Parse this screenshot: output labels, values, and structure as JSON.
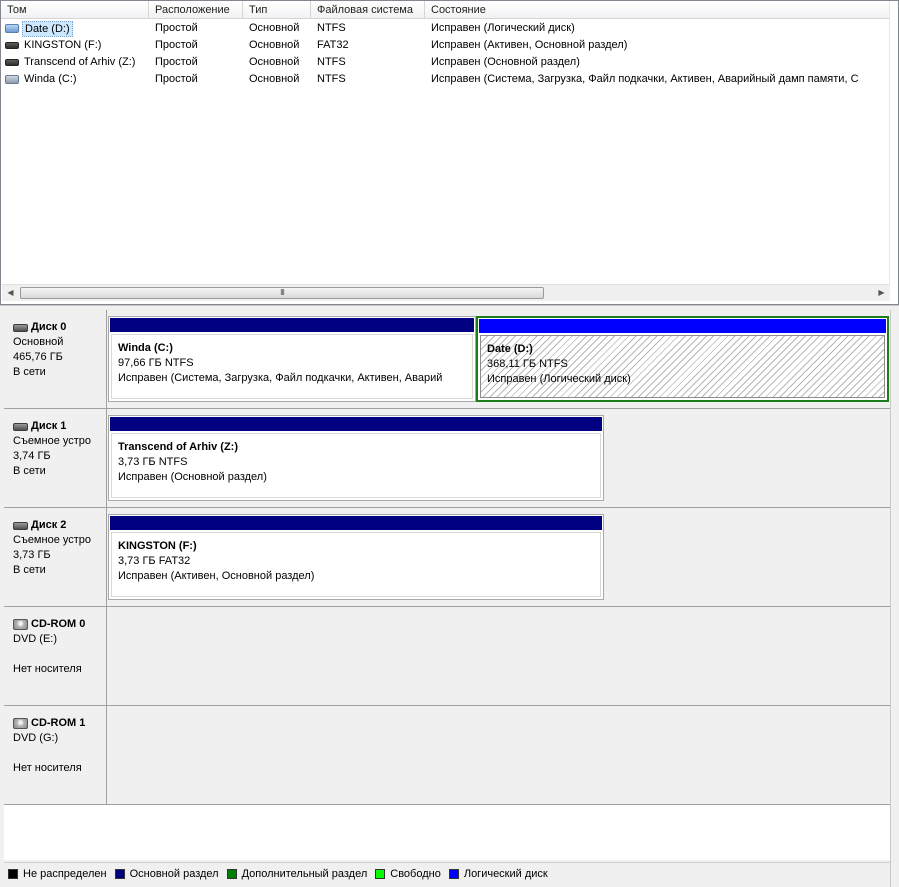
{
  "volume_list": {
    "columns": [
      "Том",
      "Расположение",
      "Тип",
      "Файловая система",
      "Состояние"
    ],
    "rows": [
      {
        "name": "Date (D:)",
        "icon": "hdd-volume-icon",
        "location": "Простой",
        "type": "Основной",
        "fs": "NTFS",
        "status": "Исправен (Логический диск)",
        "selected": true
      },
      {
        "name": "KINGSTON (F:)",
        "icon": "usb-drive-icon",
        "location": "Простой",
        "type": "Основной",
        "fs": "FAT32",
        "status": "Исправен (Активен, Основной раздел)"
      },
      {
        "name": "Transcend of Arhiv (Z:)",
        "icon": "usb-drive-icon",
        "location": "Простой",
        "type": "Основной",
        "fs": "NTFS",
        "status": "Исправен (Основной раздел)"
      },
      {
        "name": "Winda (C:)",
        "icon": "hdd-volume-icon",
        "location": "Простой",
        "type": "Основной",
        "fs": "NTFS",
        "status": "Исправен (Система, Загрузка, Файл подкачки, Активен, Аварийный дамп памяти, С"
      }
    ],
    "hscroll_grip": "III"
  },
  "disks": [
    {
      "name": "Диск 0",
      "kind": "Основной",
      "size": "465,76 ГБ",
      "state": "В сети",
      "partitions": [
        {
          "name": "Winda  (C:)",
          "size_fs": "97,66 ГБ NTFS",
          "status": "Исправен (Система, Загрузка, Файл подкачки, Активен, Аварий",
          "bar_color": "#000080"
        },
        {
          "name": "Date  (D:)",
          "size_fs": "368,11 ГБ NTFS",
          "status": "Исправен (Логический диск)",
          "bar_color": "#0000ff",
          "selected": true
        }
      ]
    },
    {
      "name": "Диск 1",
      "kind": "Съемное устро",
      "size": "3,74 ГБ",
      "state": "В сети",
      "partitions": [
        {
          "name": "Transcend of Arhiv  (Z:)",
          "size_fs": "3,73 ГБ NTFS",
          "status": "Исправен (Основной раздел)",
          "bar_color": "#000080"
        }
      ]
    },
    {
      "name": "Диск 2",
      "kind": "Съемное устро",
      "size": "3,73 ГБ",
      "state": "В сети",
      "partitions": [
        {
          "name": "KINGSTON  (F:)",
          "size_fs": "3,73 ГБ FAT32",
          "status": "Исправен (Активен, Основной раздел)",
          "bar_color": "#000080"
        }
      ]
    },
    {
      "name": "CD-ROM 0",
      "kind": "DVD (E:)",
      "state": "Нет носителя"
    },
    {
      "name": "CD-ROM 1",
      "kind": "DVD (G:)",
      "state": "Нет носителя"
    }
  ],
  "legend": [
    {
      "label": "Не распределен",
      "color": "#000000"
    },
    {
      "label": "Основной раздел",
      "color": "#000080"
    },
    {
      "label": "Дополнительный раздел",
      "color": "#008000"
    },
    {
      "label": "Свободно",
      "color": "#00ff00"
    },
    {
      "label": "Логический диск",
      "color": "#0000ff"
    }
  ]
}
